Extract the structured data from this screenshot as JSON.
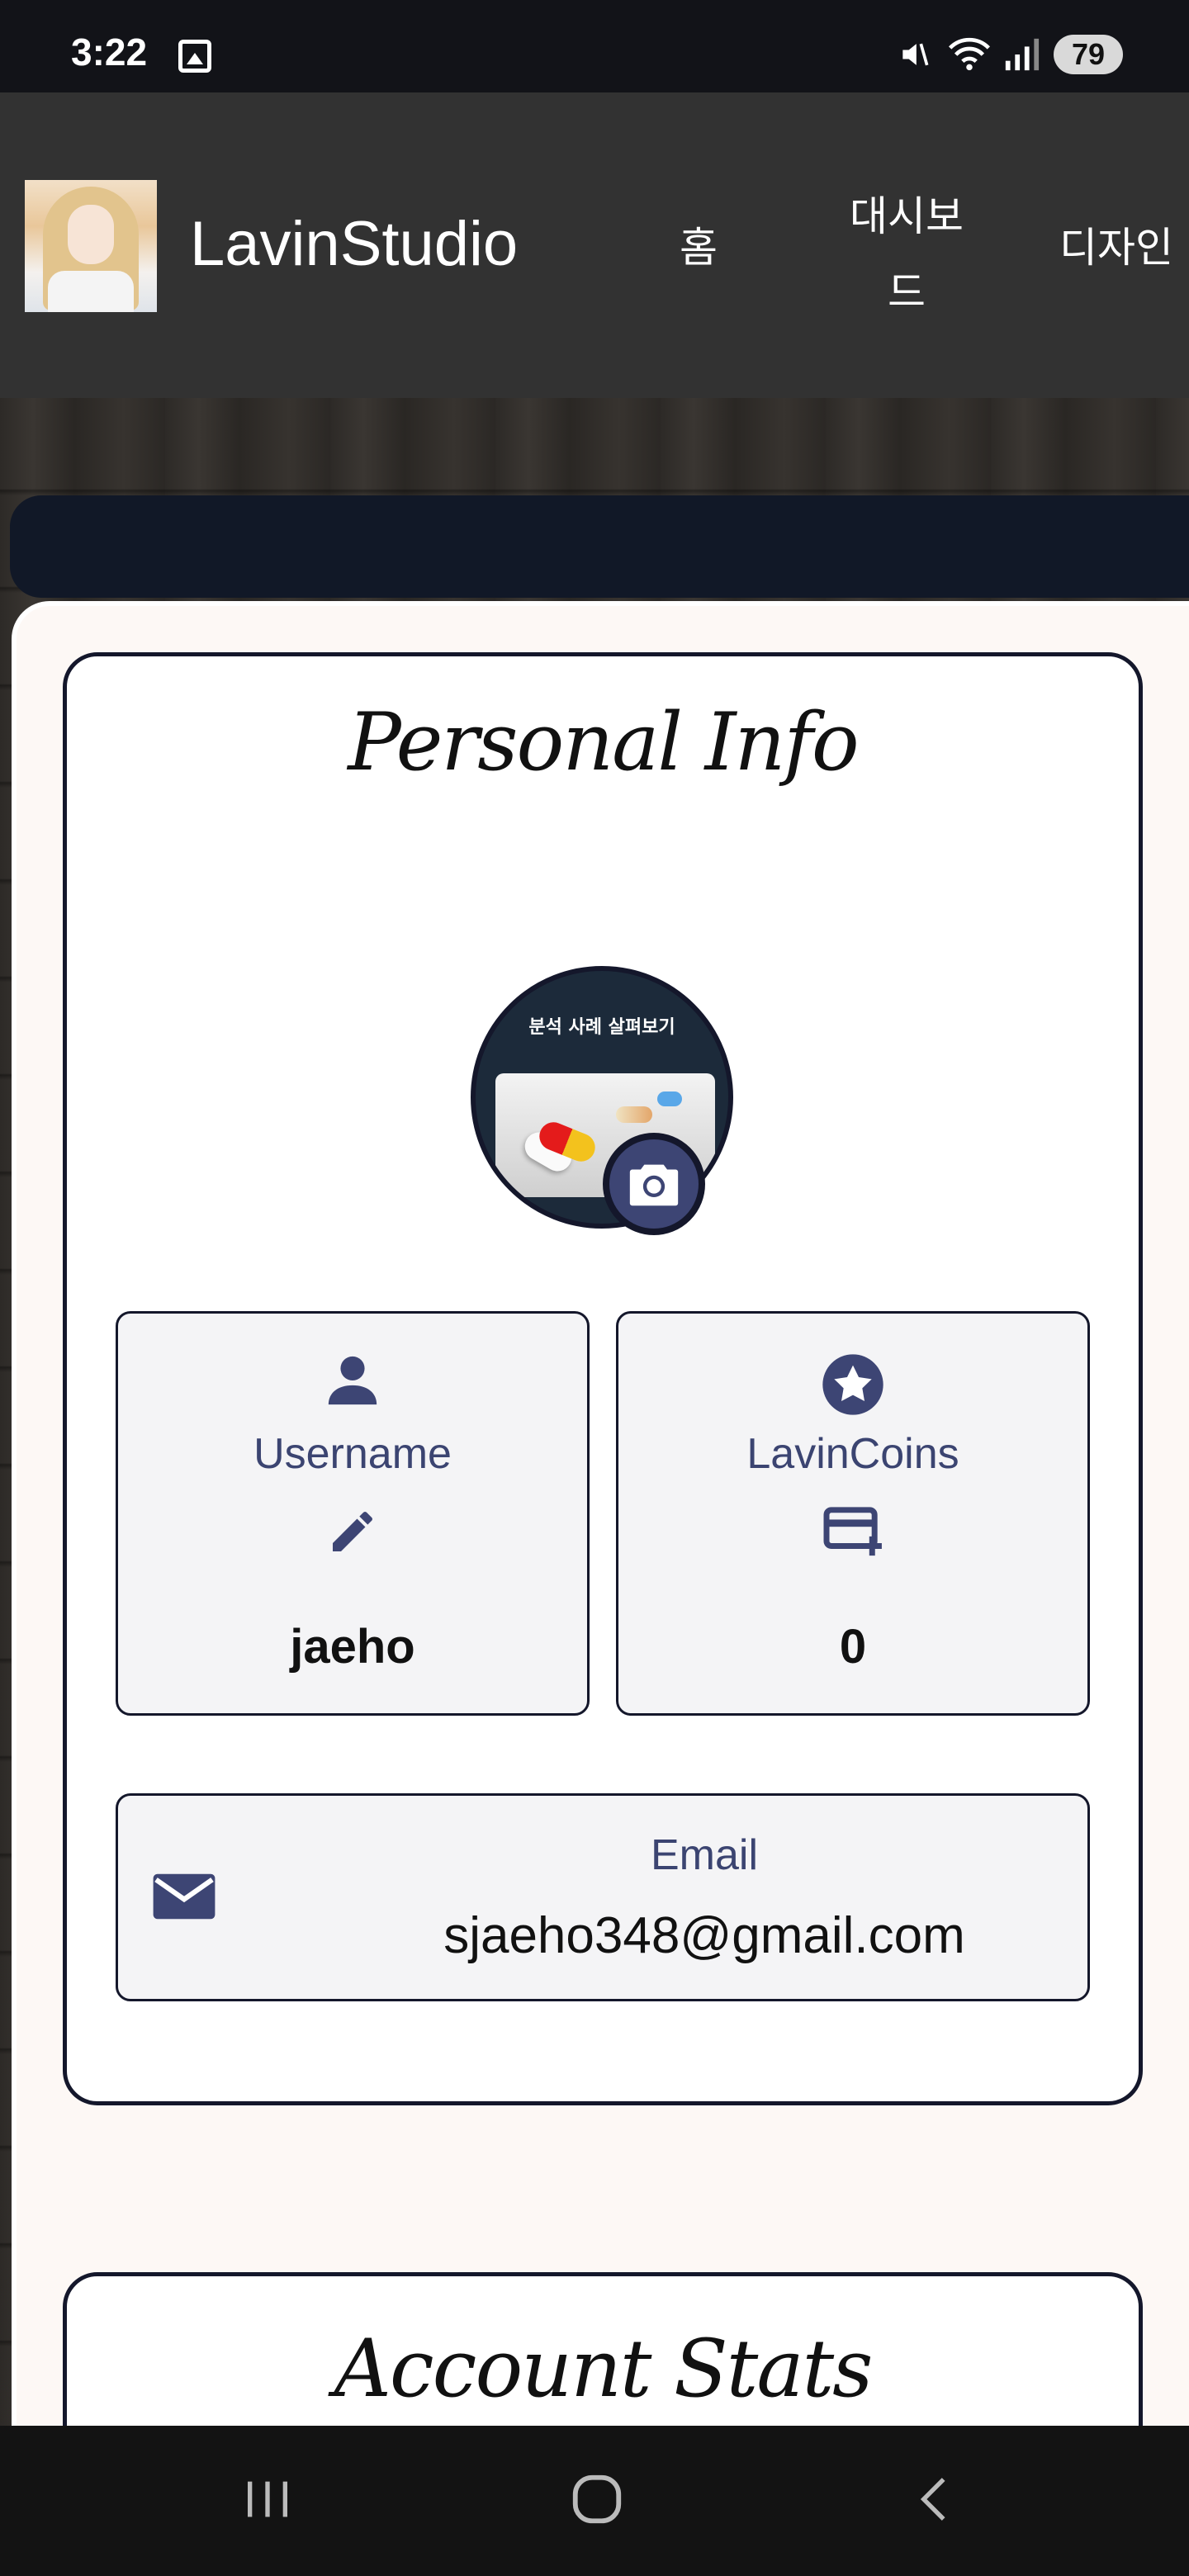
{
  "status_bar": {
    "time": "3:22",
    "battery": "79",
    "icons": [
      "image-icon",
      "mute-icon",
      "wifi-icon",
      "signal-icon",
      "battery-icon"
    ]
  },
  "header": {
    "brand": "LavinStudio",
    "nav": [
      {
        "label": "홈"
      },
      {
        "label": "대시보드"
      },
      {
        "label": "디자인"
      }
    ]
  },
  "personal_info": {
    "title": "Personal Info",
    "profile_image_caption": "분석 사례 살펴보기",
    "username": {
      "label": "Username",
      "value": "jaeho"
    },
    "coins": {
      "label": "LavinCoins",
      "value": "0"
    },
    "email": {
      "label": "Email",
      "value": "sjaeho348@gmail.com"
    }
  },
  "account_stats": {
    "title": "Account Stats"
  },
  "colors": {
    "accent": "#3d4574",
    "navy": "#111827",
    "panel": "#fdf8f5",
    "header": "#323232"
  }
}
